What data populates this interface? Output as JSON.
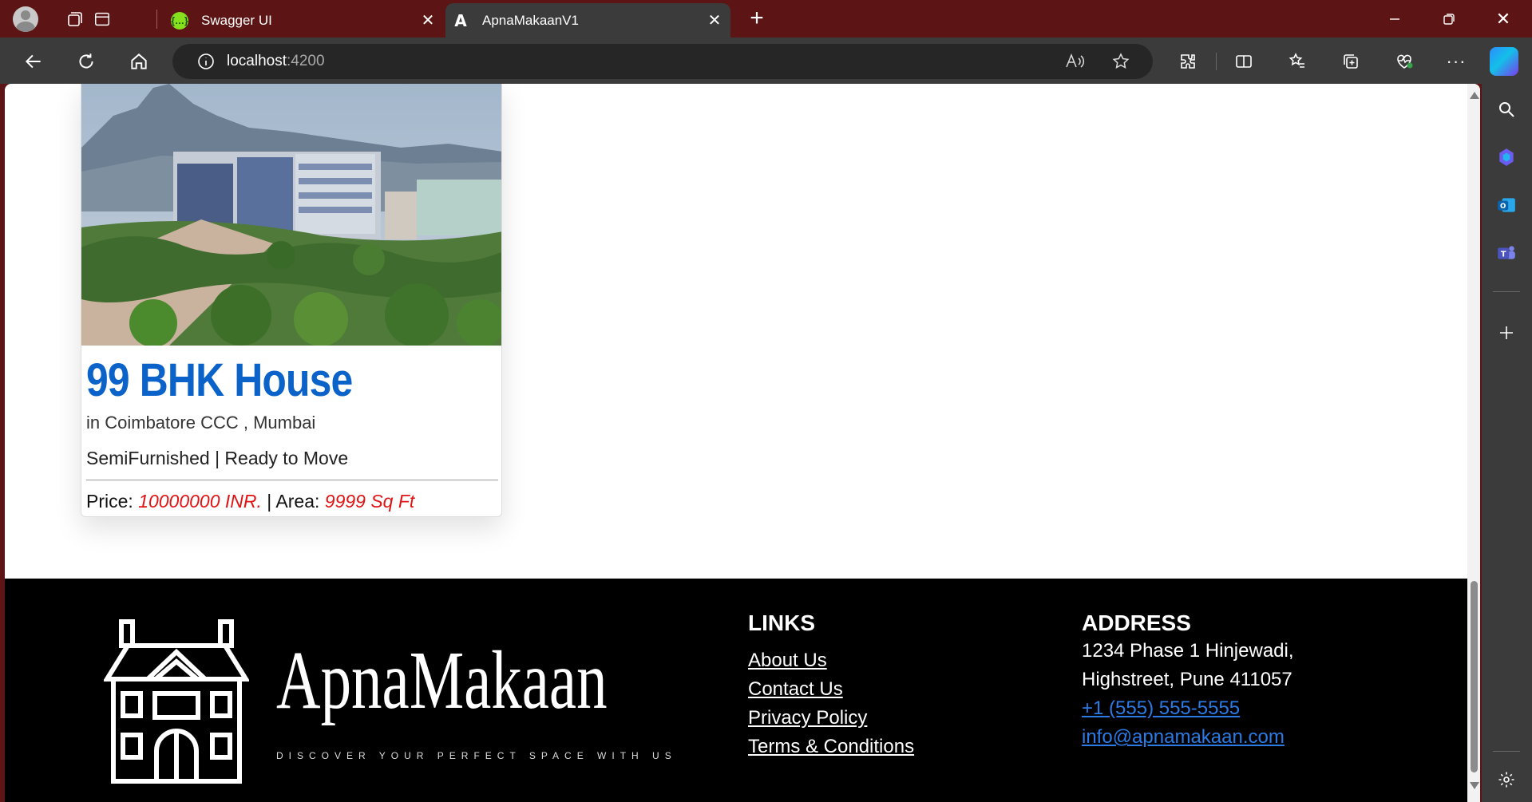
{
  "browser": {
    "tabs": [
      {
        "title": "Swagger UI",
        "favicon": "swagger-icon",
        "active": false
      },
      {
        "title": "ApnaMakaanV1",
        "favicon": "angular-icon",
        "active": true
      }
    ],
    "url_host": "localhost",
    "url_port": ":4200",
    "colors": {
      "frame": "#5c1414",
      "toolbar": "#3b3b3b"
    }
  },
  "card": {
    "title": "99 BHK House",
    "location": "in Coimbatore CCC , Mumbai",
    "status": "SemiFurnished | Ready to Move",
    "price_label": "Price: ",
    "price_value": "10000000 INR.",
    "area_label": " | Area: ",
    "area_value": "9999 Sq Ft",
    "colors": {
      "title": "#0b63c9",
      "values": "#e01414"
    }
  },
  "footer": {
    "brand": "ApnaMakaan",
    "tagline": "DISCOVER YOUR PERFECT SPACE WITH US",
    "links_heading": "LINKS",
    "links": [
      "About Us",
      "Contact Us",
      "Privacy Policy",
      "Terms & Conditions"
    ],
    "address_heading": "ADDRESS",
    "address_line1": "1234 Phase 1 Hinjewadi,",
    "address_line2": "Highstreet, Pune 411057",
    "phone": "+1 (555) 555-5555",
    "email": "info@apnamakaan.com",
    "colors": {
      "background": "#000000",
      "contact": "#2c7be5"
    }
  }
}
